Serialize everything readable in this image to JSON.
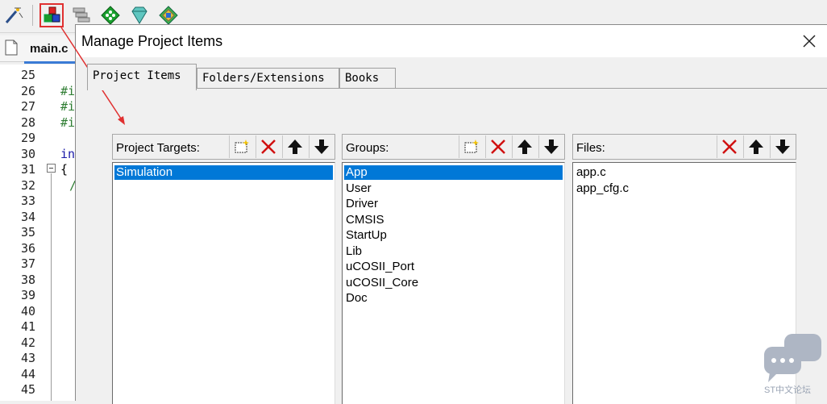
{
  "ide": {
    "toolbar_icons": [
      "wand-icon",
      "manage-project-items-icon",
      "layers-icon",
      "green-diamond-icon",
      "gem-icon",
      "pack-installer-icon"
    ],
    "editor_tab": "main.c",
    "line_numbers": [
      "25",
      "26",
      "27",
      "28",
      "29",
      "30",
      "31",
      "32",
      "33",
      "34",
      "35",
      "36",
      "37",
      "38",
      "39",
      "40",
      "41",
      "42",
      "43",
      "44",
      "45"
    ],
    "code_fragments": [
      {
        "line": "26",
        "text": "#i",
        "color": "#2e7d32"
      },
      {
        "line": "27",
        "text": "#i",
        "color": "#2e7d32"
      },
      {
        "line": "28",
        "text": "#i",
        "color": "#2e7d32"
      },
      {
        "line": "30",
        "text": "in",
        "color": "#1a1aa8"
      },
      {
        "line": "31",
        "text": "{",
        "color": "#000000"
      },
      {
        "line": "32",
        "text": "/",
        "color": "#2e7d32"
      }
    ]
  },
  "dialog": {
    "title": "Manage Project Items",
    "tabs": [
      {
        "label": "Project Items",
        "active": true
      },
      {
        "label": "Folders/Extensions",
        "active": false
      },
      {
        "label": "Books",
        "active": false
      }
    ],
    "targets": {
      "label": "Project Targets:",
      "items": [
        "Simulation"
      ],
      "selected": "Simulation"
    },
    "groups": {
      "label": "Groups:",
      "items": [
        "App",
        "User",
        "Driver",
        "CMSIS",
        "StartUp",
        "Lib",
        "uCOSII_Port",
        "uCOSII_Core",
        "Doc"
      ],
      "selected": "App"
    },
    "files": {
      "label": "Files:",
      "items": [
        "app.c",
        "app_cfg.c"
      ]
    }
  },
  "colors": {
    "selection": "#0078d7",
    "annotation_red": "#e03030",
    "delete_red": "#d01010"
  },
  "watermark": "ST中文论坛"
}
